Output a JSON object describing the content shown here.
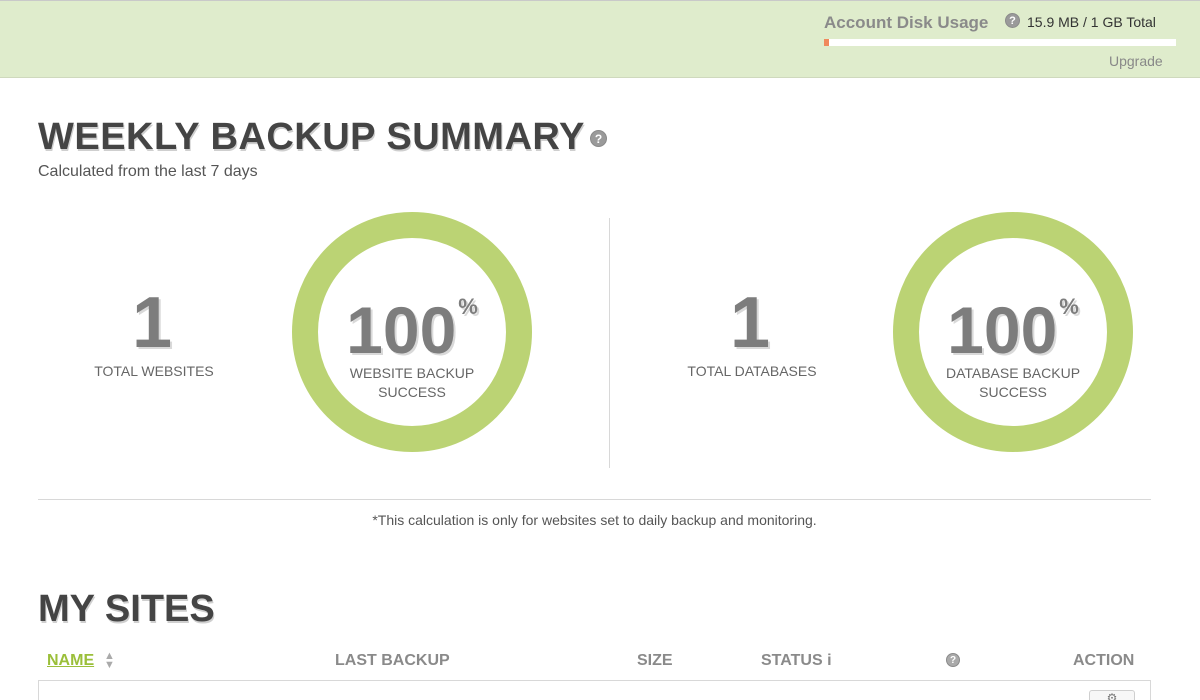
{
  "disk_usage": {
    "title": "Account Disk Usage",
    "total_text": "15.9 MB / 1 GB Total",
    "used_fraction": 0.0155,
    "upgrade_label": "Upgrade"
  },
  "summary": {
    "title": "WEEKLY BACKUP SUMMARY",
    "subtitle": "Calculated from the last 7 days",
    "total_websites": "1",
    "total_websites_label": "TOTAL WEBSITES",
    "website_success_value": "100",
    "percent_symbol": "%",
    "website_success_label_1": "WEBSITE BACKUP",
    "website_success_label_2": "SUCCESS",
    "total_databases": "1",
    "total_databases_label": "TOTAL DATABASES",
    "database_success_value": "100",
    "database_success_label_1": "DATABASE BACKUP",
    "database_success_label_2": "SUCCESS",
    "footnote": "*This calculation is only for websites set to daily backup and monitoring."
  },
  "sites": {
    "title": "MY SITES",
    "columns": {
      "name": "NAME",
      "last_backup": "LAST BACKUP",
      "size": "SIZE",
      "status": "STATUS",
      "status_info": "i",
      "action": "ACTION"
    }
  },
  "icons": {
    "help": "?",
    "sort": "▲▼",
    "action_gear": "⚙"
  },
  "colors": {
    "header_bg": "#dfeccc",
    "ring": "#bbd374",
    "accent_green": "#9bbf3a",
    "disk_fill": "#f08a5d"
  }
}
